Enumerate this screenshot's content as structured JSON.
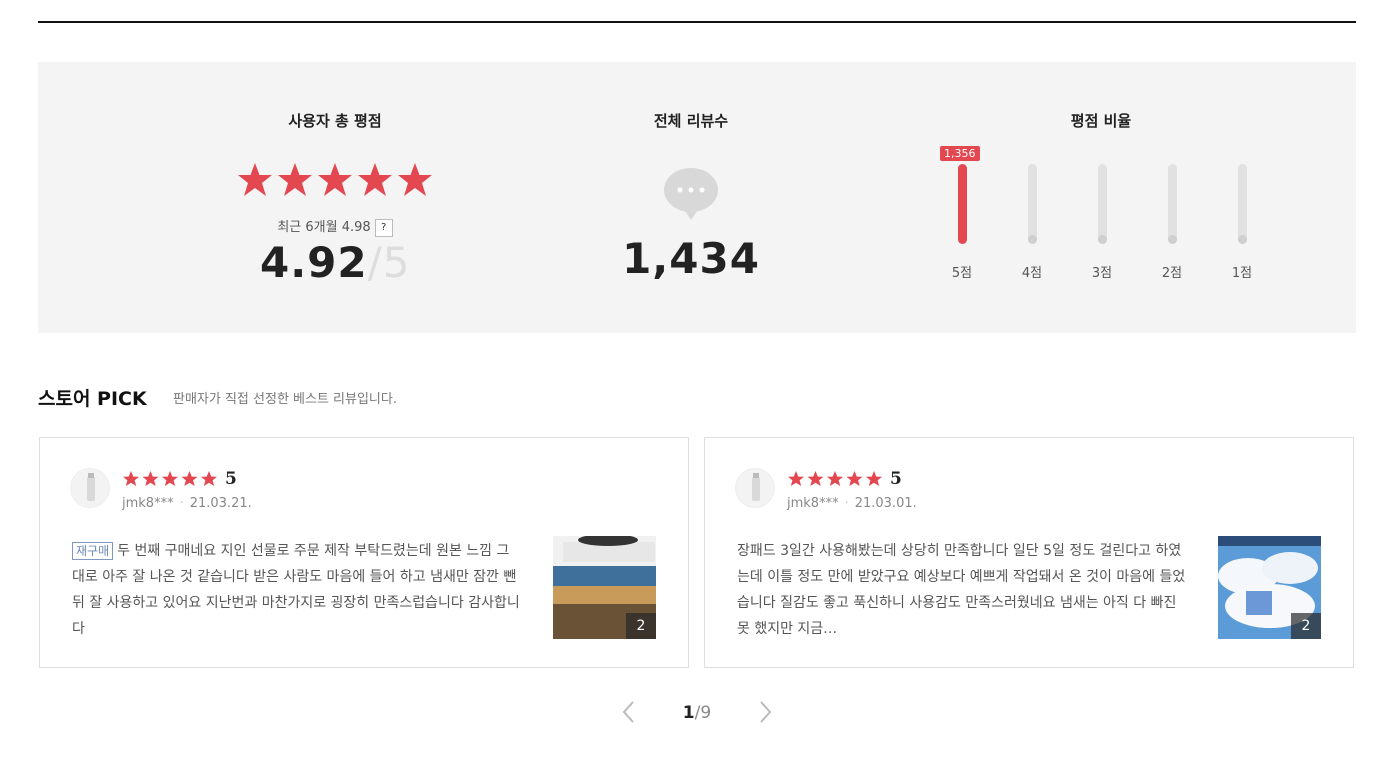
{
  "summary": {
    "rating_title": "사용자 총 평점",
    "recent_label": "최근 6개월 4.98",
    "help_label": "?",
    "score": "4.92",
    "score_of": "/5",
    "reviews_title": "전체 리뷰수",
    "review_count": "1,434",
    "ratio_title": "평점 비율",
    "ratio": [
      {
        "label": "5점",
        "fill": 1.0,
        "badge": "1,356"
      },
      {
        "label": "4점",
        "fill": 0.0
      },
      {
        "label": "3점",
        "fill": 0.0
      },
      {
        "label": "2점",
        "fill": 0.0
      },
      {
        "label": "1점",
        "fill": 0.0
      }
    ]
  },
  "pick": {
    "title": "스토어 PICK",
    "subtitle": "판매자가 직접 선정한 베스트 리뷰입니다."
  },
  "reviews": [
    {
      "score": "5",
      "user": "jmk8***",
      "date": "21.03.21.",
      "tag": "재구매",
      "text": "두 번째 구매네요 지인 선물로 주문 제작 부탁드렸는데 원본 느낌 그대로 아주 잘 나온 것 같습니다 받은 사람도 마음에 들어 하고 냄새만 잠깐 뺀 뒤 잘 사용하고 있어요 지난번과 마찬가지로 굉장히 만족스럽습니다 감사합니다",
      "photo_count": "2"
    },
    {
      "score": "5",
      "user": "jmk8***",
      "date": "21.03.01.",
      "text": "장패드 3일간 사용해봤는데 상당히 만족합니다 일단 5일 정도 걸린다고 하였는데 이틀 정도 만에 받았구요 예상보다 예쁘게 작업돼서 온 것이 마음에 들었습니다 질감도 좋고 푹신하니 사용감도 만족스러웠네요 냄새는 아직 다 빠진 못 했지만 지금…",
      "photo_count": "2"
    }
  ],
  "pagination": {
    "current": "1",
    "total": "/9"
  },
  "colors": {
    "accent": "#e34850",
    "panel": "#f4f4f4"
  }
}
